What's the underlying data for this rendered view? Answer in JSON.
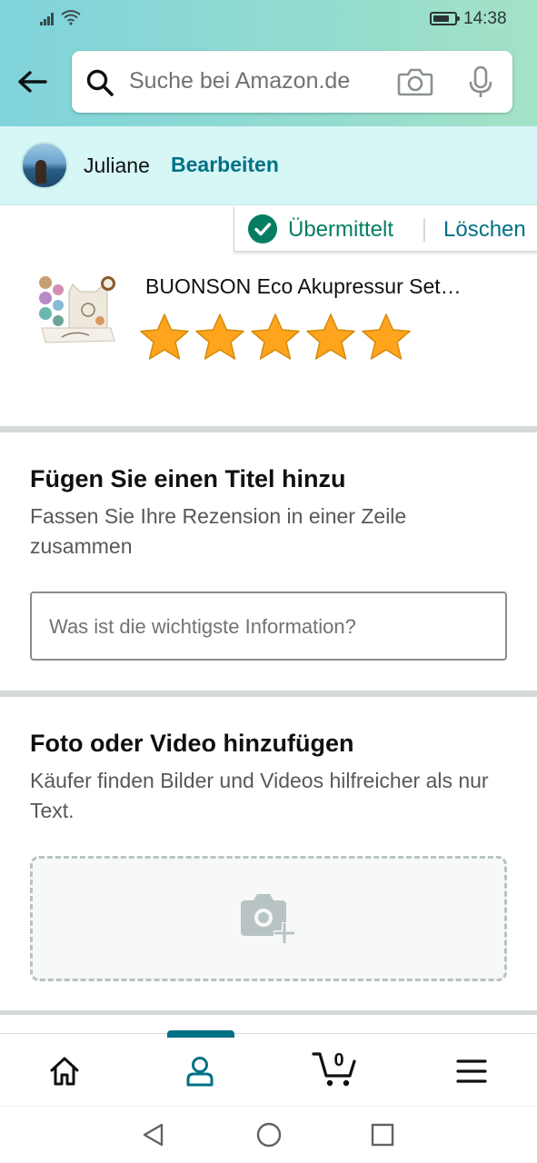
{
  "status_bar": {
    "time": "14:38",
    "battery_level": 0.75
  },
  "search": {
    "placeholder": "Suche bei Amazon.de"
  },
  "user": {
    "name": "Juliane",
    "edit_label": "Bearbeiten"
  },
  "review_status": {
    "state": "Übermittelt",
    "delete_label": "Löschen"
  },
  "product": {
    "title": "BUONSON Eco Akupressur Set…",
    "rating": 5,
    "rating_max": 5
  },
  "title_section": {
    "heading": "Fügen Sie einen Titel hinzu",
    "subtitle": "Fassen Sie Ihre Rezension in einer Zeile zusammen",
    "input_placeholder": "Was ist die wichtigste Information?"
  },
  "media_section": {
    "heading": "Foto oder Video hinzufügen",
    "subtitle": "Käufer finden Bilder und Videos hilfreicher als nur Text."
  },
  "bottom_nav": {
    "items": [
      "home-icon",
      "account-icon",
      "cart-icon",
      "menu-icon"
    ],
    "active": "account-icon",
    "cart_count": "0"
  },
  "colors": {
    "accent": "#007185",
    "success": "#067d62",
    "star": "#ffa41c"
  }
}
